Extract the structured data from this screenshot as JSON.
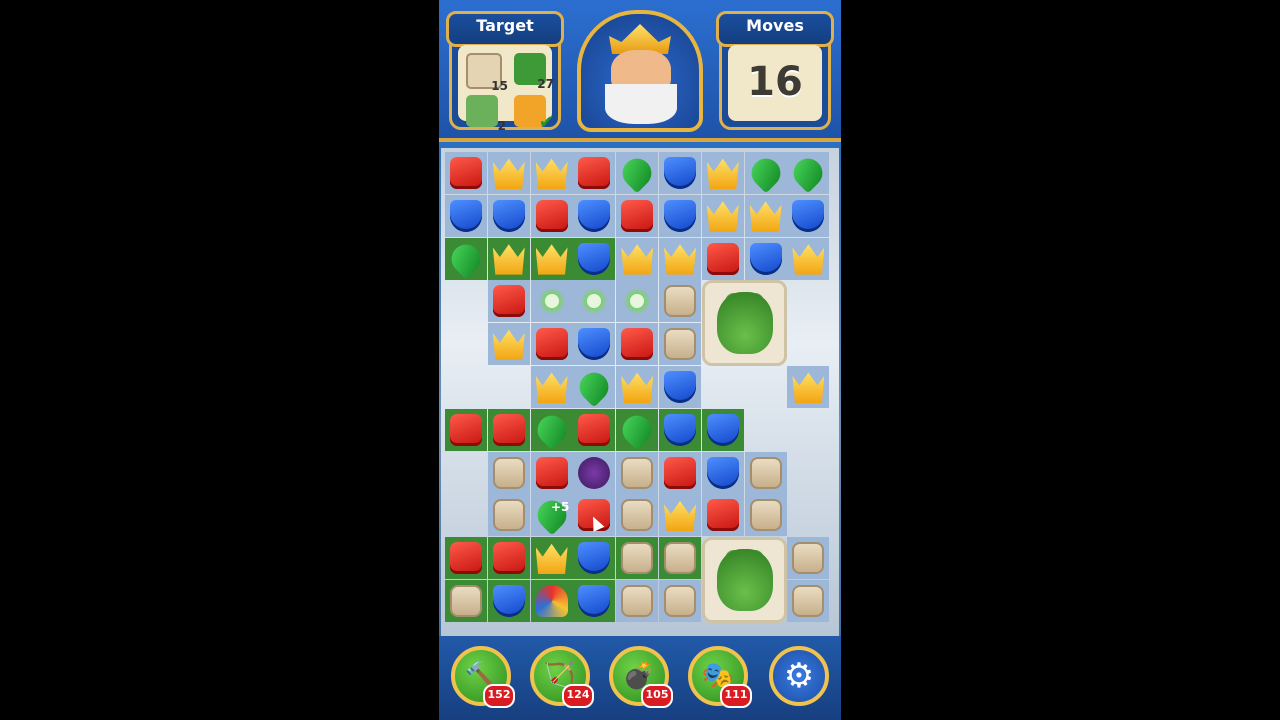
{
  "header": {
    "target_label": "Target",
    "moves_label": "Moves",
    "moves_value": "16",
    "targets": [
      {
        "icon": "bag-icon",
        "count": "15"
      },
      {
        "icon": "grass-icon",
        "count": "27"
      },
      {
        "icon": "flower-tile-icon",
        "count": "2"
      },
      {
        "icon": "orange-tile-icon",
        "count": "",
        "done": true
      }
    ]
  },
  "board": {
    "cols": 9,
    "rows": 11,
    "grid": [
      [
        "red",
        "crown",
        "crown",
        "red",
        "green",
        "blue",
        "crown",
        "green",
        "green"
      ],
      [
        "blue",
        "blue",
        "red",
        "blue",
        "red",
        "blue",
        "crown",
        "crown",
        "blue"
      ],
      [
        "green",
        "crown",
        "crown",
        "blue",
        "crown",
        "crown",
        "red",
        "blue",
        "crown"
      ],
      [
        "",
        "red",
        "sprout",
        "sprout",
        "sprout",
        "bag",
        "bear",
        "bear",
        ""
      ],
      [
        "",
        "crown",
        "red",
        "blue",
        "red",
        "bag",
        "bear",
        "bear",
        ""
      ],
      [
        "",
        "",
        "crown",
        "green",
        "crown",
        "blue",
        "",
        "",
        "crown"
      ],
      [
        "red",
        "red",
        "green",
        "red",
        "green",
        "blue",
        "blue",
        "",
        ""
      ],
      [
        "",
        "bag",
        "red",
        "bomb",
        "bag",
        "red",
        "blue",
        "bag",
        ""
      ],
      [
        "",
        "bag",
        "green",
        "red",
        "bag",
        "crown",
        "red",
        "bag",
        ""
      ],
      [
        "red",
        "red",
        "crown",
        "blue",
        "bag",
        "bag",
        "bear2",
        "bear2",
        "bag"
      ],
      [
        "bag",
        "blue",
        "jester",
        "blue",
        "bag",
        "bag",
        "bear2",
        "bear2",
        "bag"
      ]
    ],
    "bonus_text": "+5"
  },
  "boosters": [
    {
      "name": "hammer",
      "icon": "hammer-icon",
      "count": "152"
    },
    {
      "name": "arrow",
      "icon": "arrow-icon",
      "count": "124"
    },
    {
      "name": "cannon",
      "icon": "cannon-icon",
      "count": "105"
    },
    {
      "name": "jester",
      "icon": "jester-hat-icon",
      "count": "111"
    }
  ],
  "settings": {
    "icon": "gear-icon"
  }
}
